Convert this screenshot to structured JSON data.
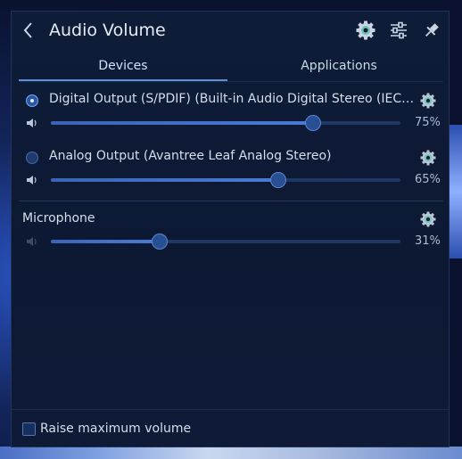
{
  "header": {
    "title": "Audio Volume",
    "icons": [
      "back-icon",
      "settings-icon",
      "mixer-icon",
      "pin-icon"
    ]
  },
  "tabs": [
    {
      "label": "Devices",
      "active": true
    },
    {
      "label": "Applications",
      "active": false
    }
  ],
  "devices": [
    {
      "label": "Digital Output (S/PDIF) (Built-in Audio Digital Stereo (IEC…",
      "selected": true,
      "volume_text": "75%",
      "volume": 75
    },
    {
      "label": "Analog Output (Avantree Leaf Analog Stereo)",
      "selected": false,
      "volume_text": "65%",
      "volume": 65
    }
  ],
  "microphone": {
    "label": "Microphone",
    "volume_text": "31%",
    "volume": 31,
    "muted": true
  },
  "footer": {
    "checkbox_label": "Raise maximum volume",
    "checked": false
  },
  "colors": {
    "accent": "#5b8fd6",
    "panel_bg": "#0f1c38",
    "settings_icon": "#6fc3b6"
  }
}
